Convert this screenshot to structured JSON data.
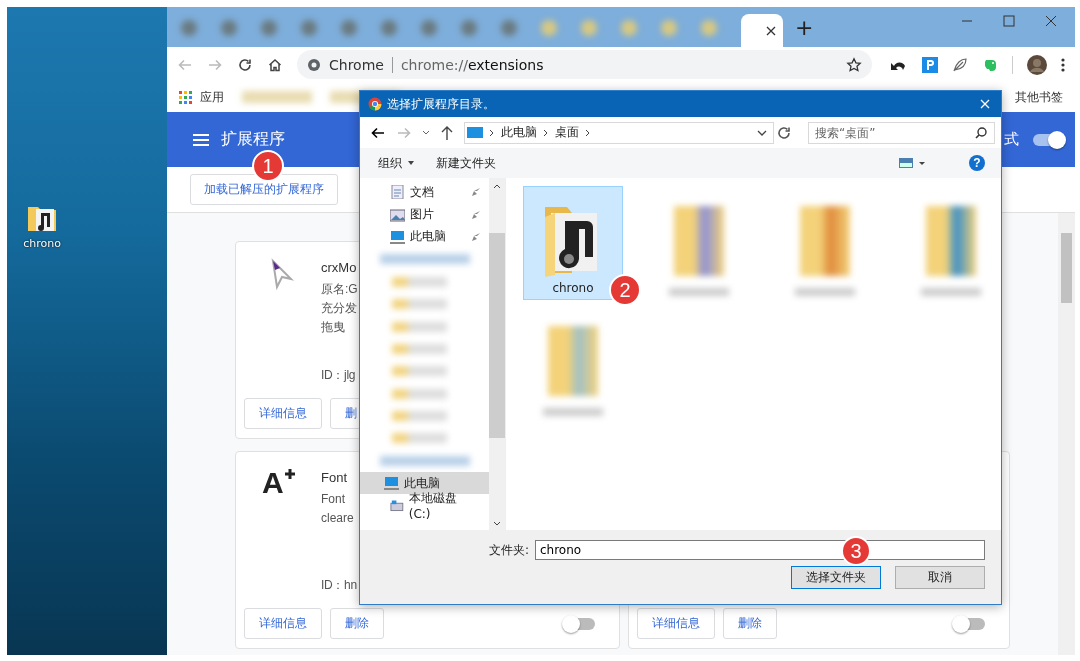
{
  "desktop": {
    "icon_label": "chrono"
  },
  "browser": {
    "new_tab": "+",
    "address": {
      "site": "Chrome",
      "scheme": "chrome://",
      "path": "extensions"
    },
    "bookmarks": [
      {
        "label": "应用"
      }
    ],
    "other_bookmarks": "其他书签",
    "page": {
      "title": "扩展程序",
      "dev_mode": {
        "label": "式",
        "on": true
      },
      "load_button": {
        "label": "加载已解压的扩展程序",
        "marker": "1"
      },
      "cards": [
        {
          "name": "crxMo",
          "lines": [
            "原名:G",
            "充分发",
            "拖曳"
          ],
          "id": "ID：jlg",
          "buttons": [
            "详细信息",
            "删"
          ]
        },
        {
          "logo": "A",
          "name": "Font",
          "lines": [
            "Font",
            "cleare"
          ],
          "id": "ID：hn",
          "buttons": [
            "详细信息",
            "删除"
          ],
          "enabled": false
        },
        {
          "buttons": [
            "详细信息",
            "删除"
          ],
          "enabled": false
        }
      ]
    }
  },
  "dialog": {
    "title": "选择扩展程序目录。",
    "help": "?",
    "breadcrumb": [
      "此电脑",
      "桌面"
    ],
    "search_placeholder": "搜索“桌面”",
    "toolbar": [
      {
        "label": "组织",
        "dropdown": true
      },
      {
        "label": "新建文件夹",
        "dropdown": false
      }
    ],
    "nav": [
      {
        "kind": "document",
        "label": "文档",
        "pinned": true,
        "selected": false
      },
      {
        "kind": "picture",
        "label": "图片",
        "pinned": true,
        "selected": false
      },
      {
        "kind": "computer",
        "label": "此电脑",
        "pinned": true,
        "selected": false
      },
      {
        "kind": "blurred",
        "selected": false
      },
      {
        "kind": "blurred",
        "selected": false
      },
      {
        "kind": "blurred",
        "selected": false
      },
      {
        "kind": "blurred",
        "selected": false
      },
      {
        "kind": "blurred",
        "selected": false
      },
      {
        "kind": "blurred",
        "selected": false
      },
      {
        "kind": "blurred",
        "selected": false
      },
      {
        "kind": "blurred",
        "selected": false
      },
      {
        "kind": "blurred",
        "selected": false
      },
      {
        "kind": "blurred",
        "selected": false
      },
      {
        "kind": "computer",
        "label": "此电脑",
        "pinned": false,
        "selected": true
      },
      {
        "kind": "drive",
        "label": "本地磁盘 (C:)",
        "pinned": false,
        "selected": false
      }
    ],
    "files": [
      {
        "kind": "item",
        "label": "chrono",
        "selected": true,
        "marker": "2"
      },
      {
        "kind": "blurred",
        "selected": false
      },
      {
        "kind": "blurred",
        "selected": false
      },
      {
        "kind": "blurred",
        "selected": false
      },
      {
        "kind": "blurred",
        "selected": false
      }
    ],
    "folder_label": "文件夹:",
    "folder_value": "chrono",
    "buttons": [
      {
        "label": "选择文件夹",
        "default": true,
        "marker": "3"
      },
      {
        "label": "取消",
        "default": false
      }
    ]
  }
}
